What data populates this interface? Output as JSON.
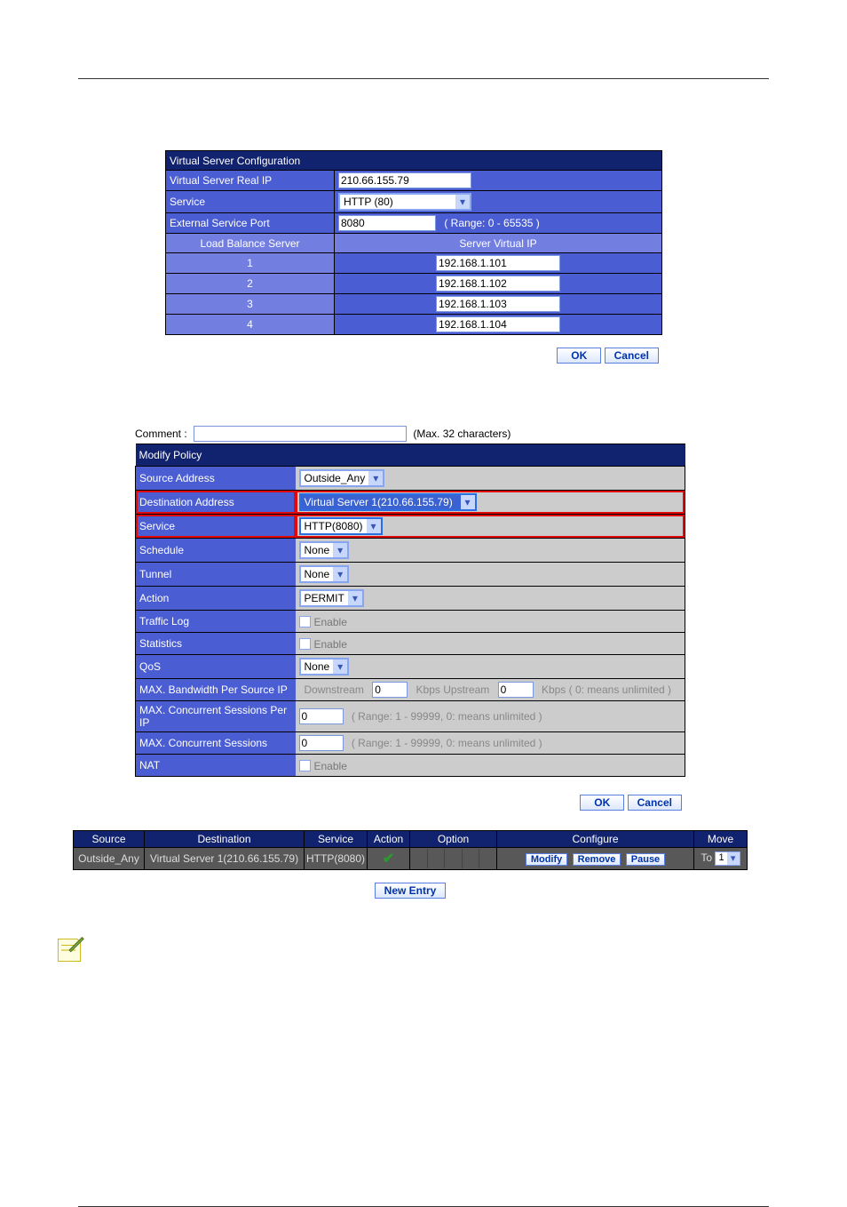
{
  "vs": {
    "title": "Virtual Server Configuration",
    "real_ip_label": "Virtual Server Real IP",
    "real_ip": "210.66.155.79",
    "service_label": "Service",
    "service": "HTTP (80)",
    "ext_port_label": "External Service Port",
    "ext_port": "8080",
    "ext_port_range": "( Range: 0 - 65535 )",
    "lb_header": "Load Balance Server",
    "vip_header": "Server Virtual IP",
    "rows": [
      {
        "n": "1",
        "ip": "192.168.1.101"
      },
      {
        "n": "2",
        "ip": "192.168.1.102"
      },
      {
        "n": "3",
        "ip": "192.168.1.103"
      },
      {
        "n": "4",
        "ip": "192.168.1.104"
      }
    ]
  },
  "buttons": {
    "ok": "OK",
    "cancel": "Cancel",
    "new_entry": "New Entry",
    "modify": "Modify",
    "remove": "Remove",
    "pause": "Pause"
  },
  "comment": {
    "label": "Comment :",
    "value": "",
    "max": "(Max. 32 characters)"
  },
  "policy": {
    "title": "Modify Policy",
    "rows": {
      "src_addr": {
        "label": "Source Address",
        "value": "Outside_Any"
      },
      "dst_addr": {
        "label": "Destination Address",
        "value": "Virtual Server 1(210.66.155.79)"
      },
      "service": {
        "label": "Service",
        "value": "HTTP(8080)"
      },
      "schedule": {
        "label": "Schedule",
        "value": "None"
      },
      "tunnel": {
        "label": "Tunnel",
        "value": "None"
      },
      "action": {
        "label": "Action",
        "value": "PERMIT"
      },
      "traffic": {
        "label": "Traffic Log",
        "enable": "Enable"
      },
      "stats": {
        "label": "Statistics",
        "enable": "Enable"
      },
      "qos": {
        "label": "QoS",
        "value": "None"
      },
      "bw": {
        "label": "MAX. Bandwidth Per Source IP",
        "down_lbl": "Downstream",
        "down": "0",
        "mid": "Kbps Upstream",
        "up": "0",
        "tail": "Kbps ( 0: means unlimited )"
      },
      "sess_ip": {
        "label": "MAX. Concurrent Sessions Per IP",
        "value": "0",
        "range": "( Range: 1 - 99999, 0: means unlimited )"
      },
      "sess": {
        "label": "MAX. Concurrent Sessions",
        "value": "0",
        "range": "( Range: 1 - 99999, 0: means unlimited )"
      },
      "nat": {
        "label": "NAT",
        "enable": "Enable"
      }
    }
  },
  "summary": {
    "headers": {
      "source": "Source",
      "dest": "Destination",
      "service": "Service",
      "action": "Action",
      "option": "Option",
      "configure": "Configure",
      "move": "Move"
    },
    "row": {
      "source": "Outside_Any",
      "dest": "Virtual Server 1(210.66.155.79)",
      "service": "HTTP(8080)",
      "move_to": "To",
      "move_val": "1"
    }
  }
}
